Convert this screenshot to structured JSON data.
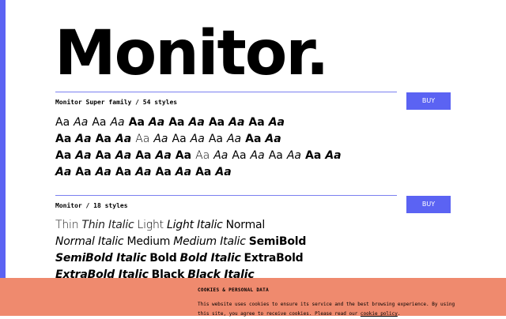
{
  "brand": {
    "title": "Monitor."
  },
  "families": [
    {
      "name": "Monitor Super family / 54 styles",
      "buy_label": "BUY"
    },
    {
      "name": "Monitor / 18 styles",
      "buy_label": "BUY"
    }
  ],
  "super_family": {
    "sample_text": "Aa",
    "rows": [
      [
        "w400",
        "w400 it",
        "w500",
        "w500 it",
        "w600",
        "w600 it",
        "w700",
        "w700 it",
        "w800",
        "w800 it",
        "w900",
        "w900 it"
      ],
      [
        "w900",
        "w900 it",
        "w800",
        "w800 it",
        "w300",
        "w300 it",
        "w400",
        "w400 it",
        "w500",
        "w500 it",
        "w600",
        "w600 it"
      ],
      [
        "w700",
        "w700 it",
        "w800",
        "w800 it",
        "w900",
        "w900 it",
        "w900",
        "w300",
        "w300 it",
        "w400",
        "w400 it",
        "w500",
        "w500 it",
        "w600",
        "w600 it"
      ],
      [
        "w700 it",
        "w700",
        "w700 it",
        "w800",
        "w800 it",
        "w900",
        "w900 it",
        "w900",
        "w900 it"
      ]
    ]
  },
  "monitor_styles": {
    "rows": [
      [
        {
          "label": "Thin",
          "cls": "w100"
        },
        {
          "label": "Thin Italic",
          "cls": "w100 it"
        },
        {
          "label": "Light",
          "cls": "w300"
        },
        {
          "label": "Light Italic",
          "cls": "w300 it"
        },
        {
          "label": "Normal",
          "cls": "w400"
        }
      ],
      [
        {
          "label": "Normal Italic",
          "cls": "w400 it"
        },
        {
          "label": "Medium",
          "cls": "w500"
        },
        {
          "label": "Medium Italic",
          "cls": "w500 it"
        },
        {
          "label": "SemiBold",
          "cls": "w600"
        }
      ],
      [
        {
          "label": "SemiBold Italic",
          "cls": "w600 it"
        },
        {
          "label": "Bold",
          "cls": "w700"
        },
        {
          "label": "Bold Italic",
          "cls": "w700 it"
        },
        {
          "label": "ExtraBold",
          "cls": "w800"
        }
      ],
      [
        {
          "label": "ExtraBold Italic",
          "cls": "w800 it"
        },
        {
          "label": "Black",
          "cls": "w900"
        },
        {
          "label": "Black Italic",
          "cls": "w900 it"
        }
      ]
    ]
  },
  "cookie": {
    "title": "COOKIES & PERSONAL DATA",
    "text_before": "This website uses cookies to ensure its service and the best browsing experience. By using this site, you agree to receive cookies. Please read our ",
    "link": "cookie policy",
    "text_after": "."
  },
  "colors": {
    "accent": "#5b63f3",
    "divider": "#7b80f0",
    "cookie_bg": "#ef8a6e"
  }
}
